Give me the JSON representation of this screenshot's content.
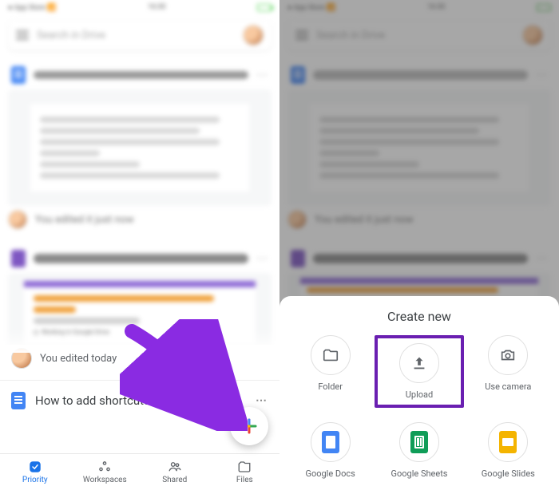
{
  "search": {
    "placeholder": "Search in Drive"
  },
  "files": {
    "upload_doc": "How to upload files...roid to Google Drive",
    "feedback_form": "G Suite Tips Training Feedback Form",
    "form_tag": "Working in Google Drive",
    "shortcuts_doc": "How to add shortcuts in Google Drive"
  },
  "activity": {
    "just_now": "You edited it just now",
    "today": "You edited today"
  },
  "tabs": {
    "priority": "Priority",
    "workspaces": "Workspaces",
    "shared": "Shared",
    "files": "Files"
  },
  "fab": {
    "label": "+"
  },
  "sheet": {
    "title": "Create new",
    "folder": "Folder",
    "upload": "Upload",
    "camera": "Use camera",
    "docs": "Google Docs",
    "sheets": "Google Sheets",
    "slides": "Google Slides"
  },
  "colors": {
    "highlight": "#6a1fb1",
    "arrow": "#8a2be2",
    "google_blue": "#4285f4"
  }
}
